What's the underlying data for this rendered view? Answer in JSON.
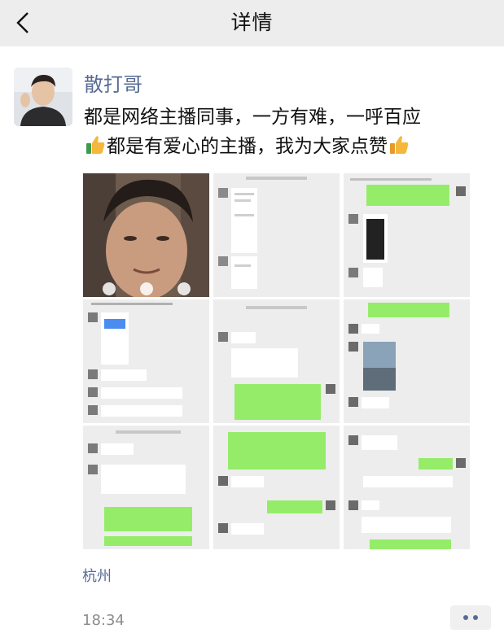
{
  "header": {
    "title": "详情",
    "back_icon": "chevron-left-icon"
  },
  "post": {
    "author": "散打哥",
    "text_line1": "都是网络主播同事，一方有难，一呼百应",
    "text_line2_main": "都是有爱心的主播，我为大家点赞",
    "emoji_icon": "thumbs-up-icon",
    "location": "杭州",
    "time": "18:34",
    "more_icon": "two-dots-icon",
    "images": [
      "video-call-screenshot",
      "chat-screenshot",
      "chat-screenshot",
      "chat-screenshot",
      "chat-screenshot",
      "chat-screenshot",
      "chat-screenshot",
      "chat-screenshot",
      "chat-screenshot"
    ]
  },
  "colors": {
    "link": "#576b95",
    "header_bg": "#ededed",
    "chat_green": "#95ec69",
    "chat_bg": "#ededed"
  }
}
